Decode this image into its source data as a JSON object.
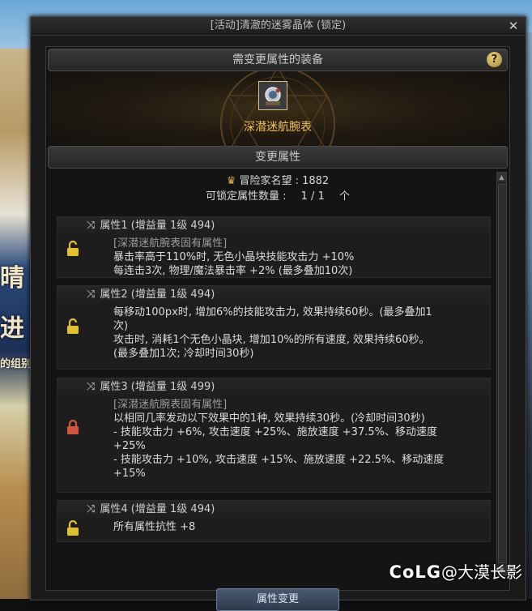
{
  "window": {
    "title": "[活动]清澈的迷雾晶体 (锁定)",
    "close": "✕"
  },
  "equip_section": {
    "header": "需变更属性的装备",
    "help": "?",
    "item_name": "深潜迷航腕表"
  },
  "change_section": {
    "header": "变更属性",
    "reputation": "冒险家名望 : 1882",
    "lockable_label": "可锁定属性数量 :",
    "lockable_value": "1 / 1",
    "lockable_unit": "个"
  },
  "attributes": [
    {
      "title": "属性1 (增益量 1级 494)",
      "locked": false,
      "lines": [
        {
          "text": "[深潜迷航腕表固有属性]",
          "muted": true
        },
        {
          "text": "暴击率高于110%时, 无色小晶块技能攻击力 +10%",
          "muted": false
        },
        {
          "text": "每连击3次, 物理/魔法暴击率 +2% (最多叠加10次)",
          "muted": false
        }
      ]
    },
    {
      "title": "属性2 (增益量 1级 494)",
      "locked": false,
      "lines": [
        {
          "text": "每移动100px时, 增加6%的技能攻击力, 效果持续60秒。(最多叠加1",
          "muted": false
        },
        {
          "text": "次)",
          "muted": false
        },
        {
          "text": "攻击时, 消耗1个无色小晶块, 增加10%的所有速度, 效果持续60秒。",
          "muted": false
        },
        {
          "text": "(最多叠加1次; 冷却时间30秒)",
          "muted": false
        }
      ]
    },
    {
      "title": "属性3 (增益量 1级 499)",
      "locked": true,
      "lines": [
        {
          "text": "[深潜迷航腕表固有属性]",
          "muted": true
        },
        {
          "text": "以相同几率发动以下效果中的1种, 效果持续30秒。(冷却时间30秒)",
          "muted": false
        },
        {
          "text": "- 技能攻击力 +6%, 攻击速度 +25%、施放速度 +37.5%、移动速度",
          "muted": false
        },
        {
          "text": "+25%",
          "muted": false
        },
        {
          "text": "- 技能攻击力 +10%, 攻击速度 +15%、施放速度 +22.5%、移动速度",
          "muted": false
        },
        {
          "text": "+15%",
          "muted": false
        }
      ]
    },
    {
      "title": "属性4 (增益量 1级 494)",
      "locked": false,
      "lines": [
        {
          "text": "所有属性抗性 +8",
          "muted": false
        }
      ]
    }
  ],
  "bottom_button": "属性变更",
  "watermark": {
    "logo": "CoLG",
    "text": "@大漠长影"
  },
  "background": {
    "left_text_1": "晴",
    "left_text_2": "进",
    "left_text_3": "的组别"
  },
  "colors": {
    "accent_gold": "#f0c25a",
    "unlocked": "#e2c02a",
    "locked": "#d2553a"
  }
}
